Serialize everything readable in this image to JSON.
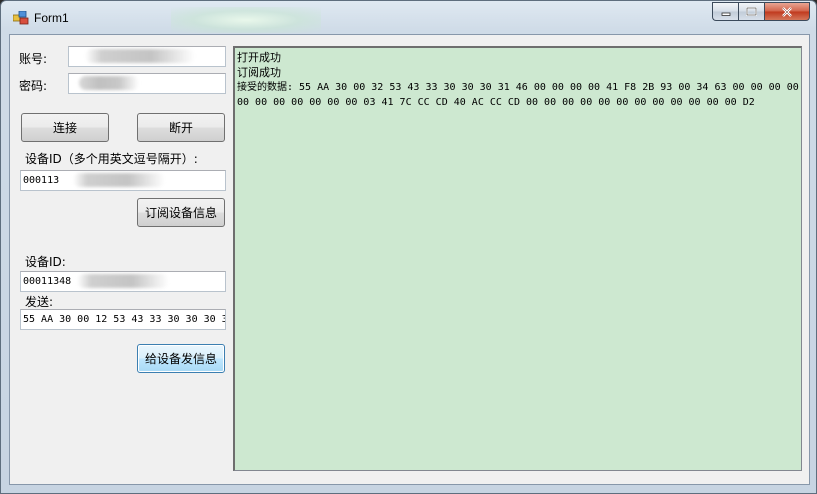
{
  "window": {
    "title": "Form1",
    "buttons": [
      "minimize",
      "maximize",
      "close"
    ]
  },
  "login": {
    "account_label": "账号:",
    "password_label": "密码:",
    "connect_button": "连接",
    "disconnect_button": "断开"
  },
  "subscribe": {
    "device_ids_label": "设备ID（多个用英文逗号隔开）:",
    "device_ids_value": "000113",
    "subscribe_button": "订阅设备信息"
  },
  "send": {
    "device_id_label": "设备ID:",
    "device_id_value": "00011348",
    "send_label": "发送:",
    "send_value": "55 AA 30 00 12 53 43 33 30 30 30 3",
    "send_button": "给设备发信息"
  },
  "output": {
    "lines": [
      "打开成功",
      "订阅成功",
      "接受的数据: 55 AA 30 00 32 53 43 33 30 30 30 31 46 00 00 00 00 41 F8 2B 93 00 34 63 00 00 00 00 00 00 00 00 00 00 00 03 41 7C CC CD 40 AC CC CD 00 00 00 00 00 00 00 00 00 00 00 00 D2"
    ],
    "background": "#cde8d0"
  },
  "colors": {
    "output_bg": "#cde8d0",
    "client_bg": "#f0f0f0",
    "button_focus_border": "#3c7fb1"
  }
}
